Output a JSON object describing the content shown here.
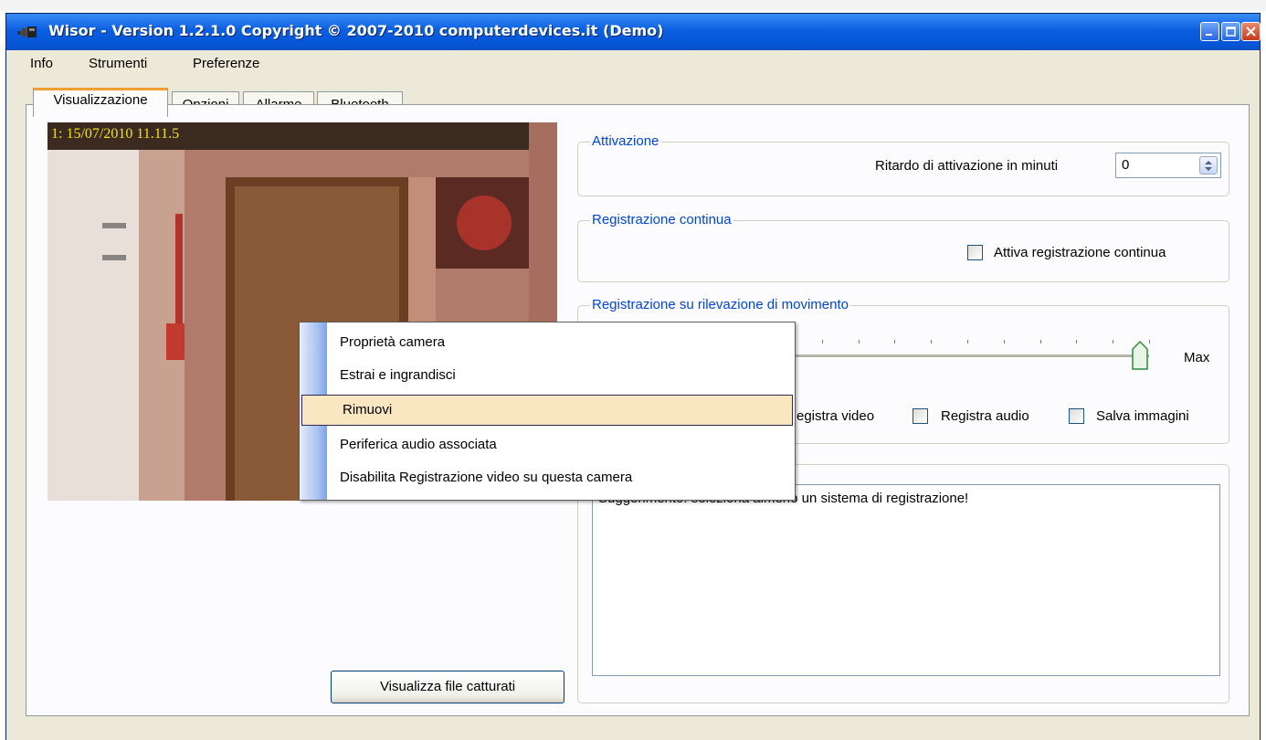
{
  "window": {
    "title": "Wisor - Version 1.2.1.0 Copyright © 2007-2010 computerdevices.it (Demo)",
    "controls": [
      "minimize",
      "maximize",
      "close"
    ]
  },
  "menu": [
    "Info",
    "Strumenti",
    "Preferenze"
  ],
  "tabs": [
    "Visualizzazione",
    "Opzioni",
    "Allarme",
    "Bluetooth"
  ],
  "active_tab": "Visualizzazione",
  "camera": {
    "timestamp": "1: 15/07/2010 11.11.5"
  },
  "view_files_button": "Visualizza file catturati",
  "attivazione": {
    "group_label": "Attivazione",
    "delay_label": "Ritardo  di attivazione in minuti",
    "delay_value": "0"
  },
  "registrazione_continua": {
    "group_label": "Registrazione continua",
    "checkbox_label": "Attiva registrazione continua",
    "checked": false
  },
  "movimento": {
    "group_label": "Registrazione su rilevazione di movimento",
    "slider_max_label": "Max",
    "slider_level": 1.0,
    "options": [
      {
        "label": "egistra video",
        "checked": false
      },
      {
        "label": "Registra audio",
        "checked": false
      },
      {
        "label": "Salva immagini",
        "checked": false
      }
    ]
  },
  "suggestion_text": "Suggerimento: seleziona almeno un sistema di registrazione!",
  "context_menu": {
    "items": [
      "Proprietà camera",
      "Estrai e ingrandisci",
      "Rimuovi",
      "Periferica audio associata",
      "Disabilita Registrazione video su questa camera"
    ],
    "highlighted": "Rimuovi"
  },
  "colors": {
    "titlebar": "#0554d4",
    "group_label": "#0046d5",
    "tab_active_accent": "#f0a030",
    "menu_highlight": "#fbe6c2",
    "timestamp": "#f3e11e"
  }
}
